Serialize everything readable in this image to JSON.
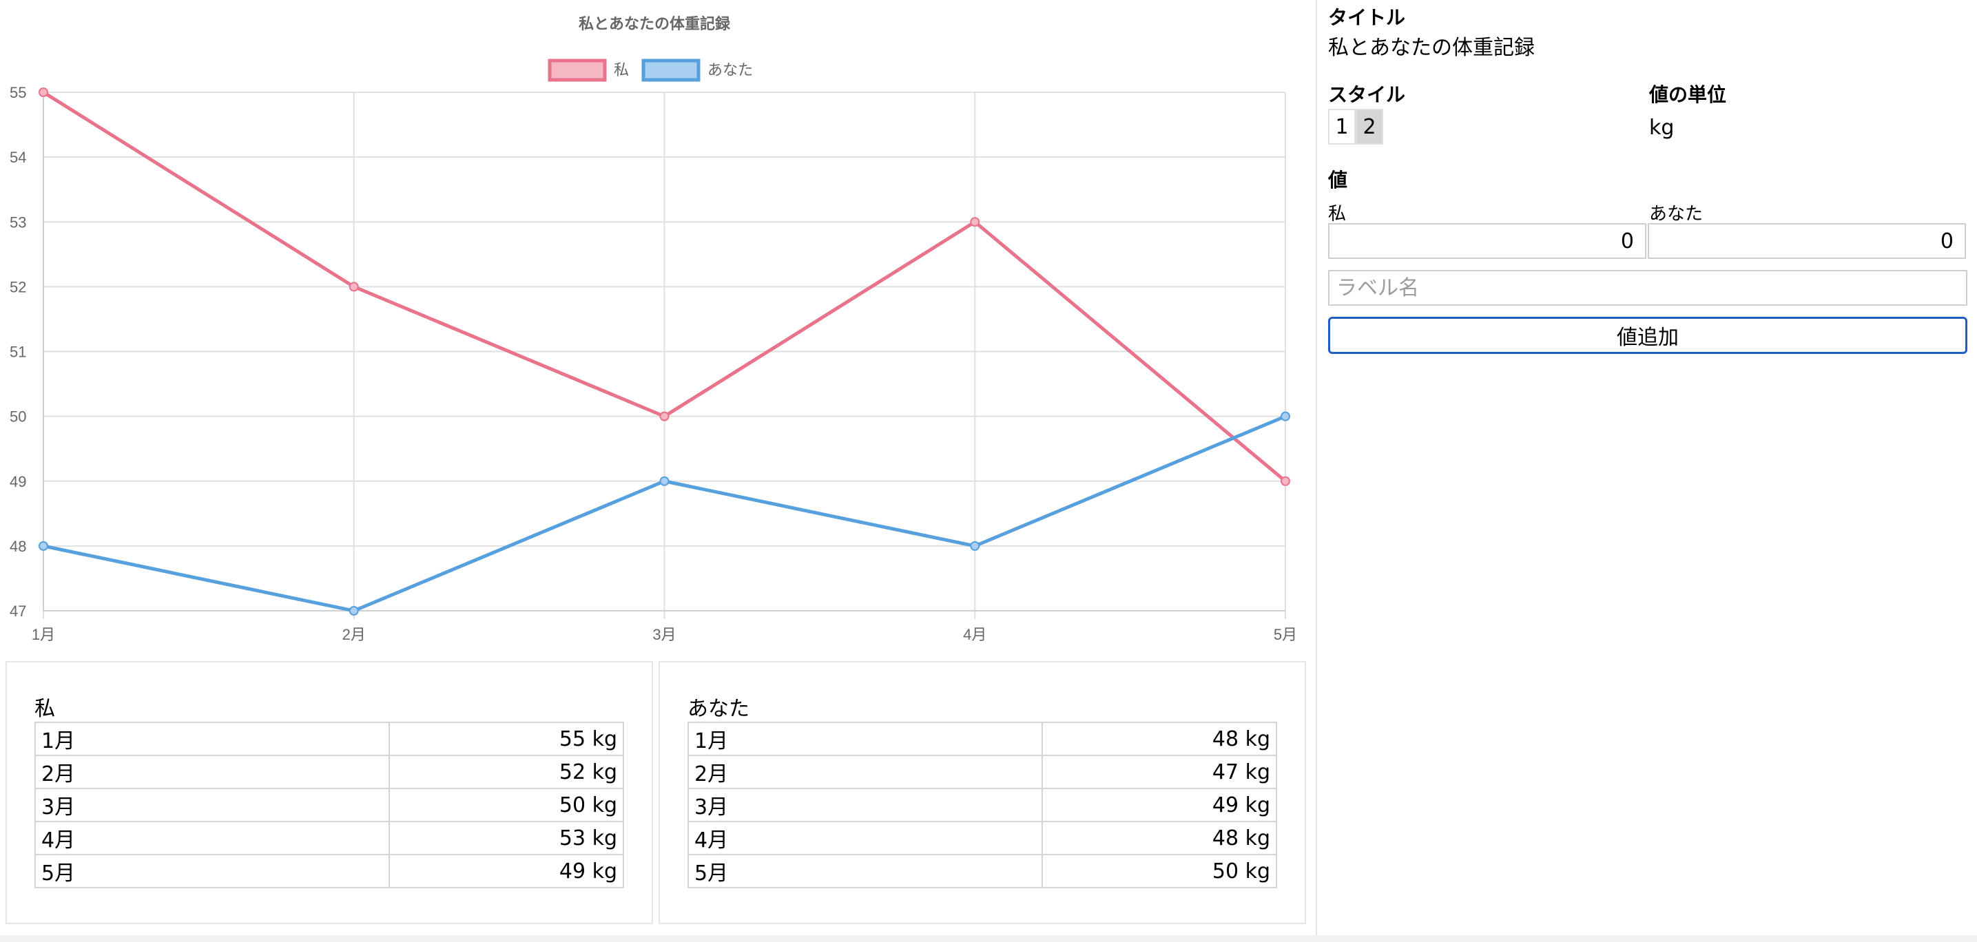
{
  "chart_data": {
    "type": "line",
    "title": "私とあなたの体重記録",
    "categories": [
      "1月",
      "2月",
      "3月",
      "4月",
      "5月"
    ],
    "series": [
      {
        "name": "私",
        "values": [
          55,
          52,
          50,
          53,
          49
        ],
        "color": "#e8738a",
        "fill": "#f6b7c4"
      },
      {
        "name": "あなた",
        "values": [
          48,
          47,
          49,
          48,
          50
        ],
        "color": "#56a0de",
        "fill": "#a9d0f2"
      }
    ],
    "ylim": [
      47,
      55
    ],
    "yticks": [
      47,
      48,
      49,
      50,
      51,
      52,
      53,
      54,
      55
    ],
    "grid": true,
    "legend": "top"
  },
  "tables": [
    {
      "title": "私",
      "rows": [
        {
          "month": "1月",
          "value": "55 kg"
        },
        {
          "month": "2月",
          "value": "52 kg"
        },
        {
          "month": "3月",
          "value": "50 kg"
        },
        {
          "month": "4月",
          "value": "53 kg"
        },
        {
          "month": "5月",
          "value": "49 kg"
        }
      ]
    },
    {
      "title": "あなた",
      "rows": [
        {
          "month": "1月",
          "value": "48 kg"
        },
        {
          "month": "2月",
          "value": "47 kg"
        },
        {
          "month": "3月",
          "value": "49 kg"
        },
        {
          "month": "4月",
          "value": "48 kg"
        },
        {
          "month": "5月",
          "value": "50 kg"
        }
      ]
    }
  ],
  "form": {
    "title_label": "タイトル",
    "title_value": "私とあなたの体重記録",
    "style_label": "スタイル",
    "style_options": [
      "1",
      "2"
    ],
    "style_selected": "2",
    "unit_label": "値の単位",
    "unit_value": "kg",
    "values_label": "値",
    "series1_label": "私",
    "series2_label": "あなた",
    "series1_value": "0",
    "series2_value": "0",
    "label_placeholder": "ラベル名",
    "add_button": "値追加"
  }
}
